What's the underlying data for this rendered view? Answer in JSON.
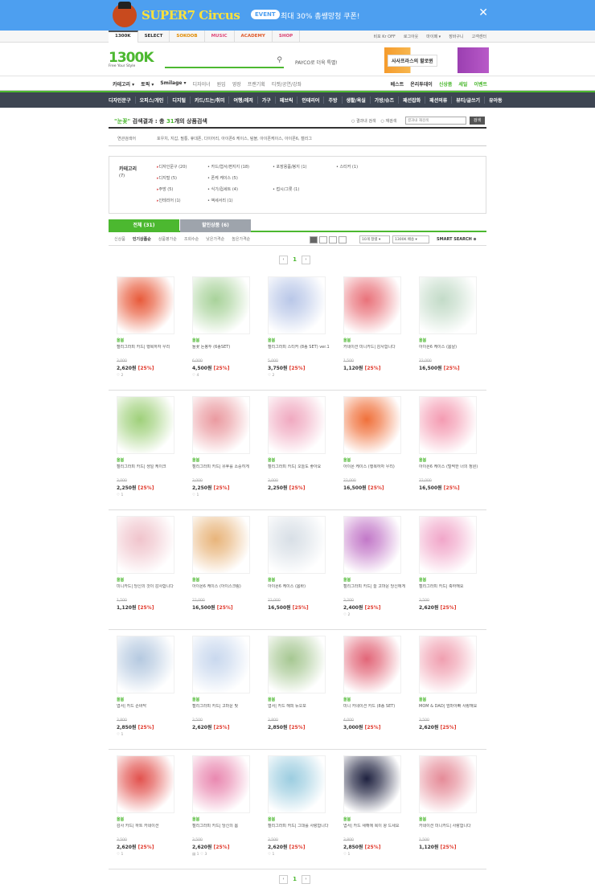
{
  "banner": {
    "title": "SUPER7 Circus",
    "event": "EVENT",
    "message": "최대 30% 총쌩망청 쿠폰!",
    "close": "✕"
  },
  "top_nav": {
    "sites": [
      "1300K",
      "SELECT",
      "SOKOOB",
      "MUSIC",
      "ACADEMY",
      "SHOP"
    ],
    "util": [
      "비포 Kr OFF",
      "로그아웃",
      "마이페 ▾",
      "장바구니",
      "고객센터"
    ]
  },
  "header": {
    "logo": "1300K",
    "tagline": "Free Your Style",
    "search_icon": "search-icon",
    "payco": "PAYCO로 더욱 특별!",
    "promo": "사사프라스의 할로윈"
  },
  "menu": {
    "left": [
      "카테고리 ▾",
      "토픽 ▾",
      "Smilage ▾",
      "디자이너",
      "원입",
      "영장",
      "프랜기획",
      "티켓/공연/강좌"
    ],
    "right": [
      "베스트",
      "온리투데이",
      "신상품",
      "세일",
      "이벤트"
    ]
  },
  "categories": [
    "디자인문구",
    "오피스/개인",
    "디지털",
    "카드/드는/취미",
    "여행/레저",
    "가구",
    "패브릭",
    "인테리어",
    "주방",
    "생활/욕실",
    "가방/슈즈",
    "패션잡화",
    "패션의류",
    "뷰티/글쓰기",
    "유아동"
  ],
  "result": {
    "query": "\"눈꽃\"",
    "label": " 검색결과 : 총 ",
    "count": "31",
    "suffix": "개의 상품검색",
    "options": [
      "결과내 검색",
      "재검색"
    ],
    "search_placeholder": "결과내 재검색",
    "button": "검색"
  },
  "related": {
    "label": "연관검색어",
    "value": "포우치, 지갑, 필통, 휴대폰, 다이어리, 아이폰6 케이스, 텀블, 아이폰케이스, 아이폰6, 캘리그"
  },
  "category_box": {
    "title": "카테고리",
    "count": "(7)",
    "items": [
      "디자인문구 (20)",
      "카드/엽서/편지지 (18)",
      "포장용품/봉지 (1)",
      "스티커 (1)",
      "디지털 (5)",
      "폰케 케이스 (5)",
      "주방 (5)",
      "식기/컵세트 (4)",
      "접시/그릇 (1)",
      "인테리어 (1)",
      "액세서리 (1)"
    ]
  },
  "tabs": {
    "all": "전체 (31)",
    "sale": "할인상품 (6)"
  },
  "sort": {
    "options": [
      "신상품",
      "인기상품순",
      "상품평가순",
      "조회수순",
      "낮은가격순",
      "높은가격순"
    ],
    "per_page": "10개 정렬 ▾",
    "per_page2": "1300K 배송 ▾",
    "smart": "SMART SEARCH ⊕"
  },
  "pager": {
    "prev": "‹",
    "current": "1",
    "next": "›"
  },
  "products": [
    {
      "brand": "올붐",
      "name": "캘리그라피 카드| 행복하자 우리",
      "orig": "3,000",
      "price": "2,620원",
      "disc": "[25%]",
      "heart": "♡ 2",
      "color": "#e85a3a"
    },
    {
      "brand": "올붐",
      "name": "들꽃 돈봉투 (6종SET)",
      "orig": "6,000",
      "price": "4,500원",
      "disc": "[25%]",
      "heart": "♡ 4",
      "color": "#a8d29a"
    },
    {
      "brand": "올붐",
      "name": "캘리그라피 스티커 (8종 SET) ver.1",
      "orig": "5,000",
      "price": "3,750원",
      "disc": "[25%]",
      "heart": "♡ 2",
      "color": "#b9c7e8"
    },
    {
      "brand": "올붐",
      "name": "카네이션 미니카드| 감사합니다",
      "orig": "1,500",
      "price": "1,120원",
      "disc": "[25%]",
      "heart": "",
      "color": "#e9727a"
    },
    {
      "brand": "올붐",
      "name": "아이폰6 케이스 (봄날)",
      "orig": "22,000",
      "price": "16,500원",
      "disc": "[25%]",
      "heart": "",
      "color": "#c3dbc8"
    },
    {
      "brand": "올붐",
      "name": "캘리그라피 카드| 생일 케이크",
      "orig": "3,000",
      "price": "2,250원",
      "disc": "[25%]",
      "heart": "♡ 1",
      "color": "#9fd07a"
    },
    {
      "brand": "올붐",
      "name": "캘리그라피 카드| 유후를 소중히게",
      "orig": "3,000",
      "price": "2,250원",
      "disc": "[25%]",
      "heart": "♡ 1",
      "color": "#ea9aa0"
    },
    {
      "brand": "올붐",
      "name": "캘리그라피 카드| 오늘도 좋아요",
      "orig": "3,000",
      "price": "2,250원",
      "disc": "[25%]",
      "heart": "",
      "color": "#f0a9c0"
    },
    {
      "brand": "올붐",
      "name": "아이폰 케이스 (행복하자 우리)",
      "orig": "22,000",
      "price": "16,500원",
      "disc": "[25%]",
      "heart": "",
      "color": "#f0703a"
    },
    {
      "brand": "올붐",
      "name": "아이폰6 케이스 (털썩한 너의 정원)",
      "orig": "22,000",
      "price": "16,500원",
      "disc": "[25%]",
      "heart": "",
      "color": "#f49bb2"
    },
    {
      "brand": "올붐",
      "name": "미니카드| 당신의 것이 감사합니다",
      "orig": "1,500",
      "price": "1,120원",
      "disc": "[25%]",
      "heart": "",
      "color": "#f0c4cc"
    },
    {
      "brand": "올붐",
      "name": "아이폰6 케이스 (아이스크림)",
      "orig": "22,000",
      "price": "16,500원",
      "disc": "[25%]",
      "heart": "",
      "color": "#e8b47a"
    },
    {
      "brand": "올붐",
      "name": "아이폰6 케이스 (봄바)",
      "orig": "22,000",
      "price": "16,500원",
      "disc": "[25%]",
      "heart": "",
      "color": "#d8dfe6"
    },
    {
      "brand": "올붐",
      "name": "캘리그라피 카드| 늘 고마운 당신에게",
      "orig": "3,200",
      "price": "2,400원",
      "disc": "[25%]",
      "heart": "♡ 2",
      "color": "#c278c8"
    },
    {
      "brand": "올붐",
      "name": "캘리그라피 카드| 축하해요",
      "orig": "3,500",
      "price": "2,620원",
      "disc": "[25%]",
      "heart": "",
      "color": "#f1a6c9"
    },
    {
      "brand": "올붐",
      "name": "엽서| 카드 손바닥",
      "orig": "3,800",
      "price": "2,850원",
      "disc": "[25%]",
      "heart": "♡ 1",
      "color": "#b5c9e0"
    },
    {
      "brand": "올붐",
      "name": "캘리그라피 카드| 고마운 빛",
      "orig": "3,500",
      "price": "2,620원",
      "disc": "[25%]",
      "heart": "",
      "color": "#c9d8ee"
    },
    {
      "brand": "올붐",
      "name": "엽서| 카드 해피 뉴오보",
      "orig": "3,800",
      "price": "2,850원",
      "disc": "[25%]",
      "heart": "",
      "color": "#a6c792"
    },
    {
      "brand": "올붐",
      "name": "미니 카네이션 카드 (8종 SET)",
      "orig": "4,000",
      "price": "3,000원",
      "disc": "[25%]",
      "heart": "",
      "color": "#e26678"
    },
    {
      "brand": "올붐",
      "name": "MOM & DAD| 엄마아빠 사랑해요",
      "orig": "3,500",
      "price": "2,620원",
      "disc": "[25%]",
      "heart": "",
      "color": "#f09fb0"
    },
    {
      "brand": "올붐",
      "name": "감사 카드| 하트 카네이션",
      "orig": "3,500",
      "price": "2,620원",
      "disc": "[25%]",
      "heart": "♡ 1",
      "color": "#e2524e"
    },
    {
      "brand": "올붐",
      "name": "캘리그라피 카드| 당신의 봄",
      "orig": "3,500",
      "price": "2,620원",
      "disc": "[25%]",
      "heart": "▤ 1  ♡ 3",
      "color": "#e988b0"
    },
    {
      "brand": "올붐",
      "name": "캘리그라피 카드| 그대를 사랑합니다",
      "orig": "3,500",
      "price": "2,620원",
      "disc": "[25%]",
      "heart": "♡ 1",
      "color": "#9ccde0"
    },
    {
      "brand": "올붐",
      "name": "엽서| 카드 새해에 복이 왕 드세요",
      "orig": "3,800",
      "price": "2,850원",
      "disc": "[25%]",
      "heart": "♡ 1",
      "color": "#1f2240"
    },
    {
      "brand": "올붐",
      "name": "카네이션 미니카드| 사랑합니다",
      "orig": "1,500",
      "price": "1,120원",
      "disc": "[25%]",
      "heart": "",
      "color": "#e58b98"
    }
  ]
}
